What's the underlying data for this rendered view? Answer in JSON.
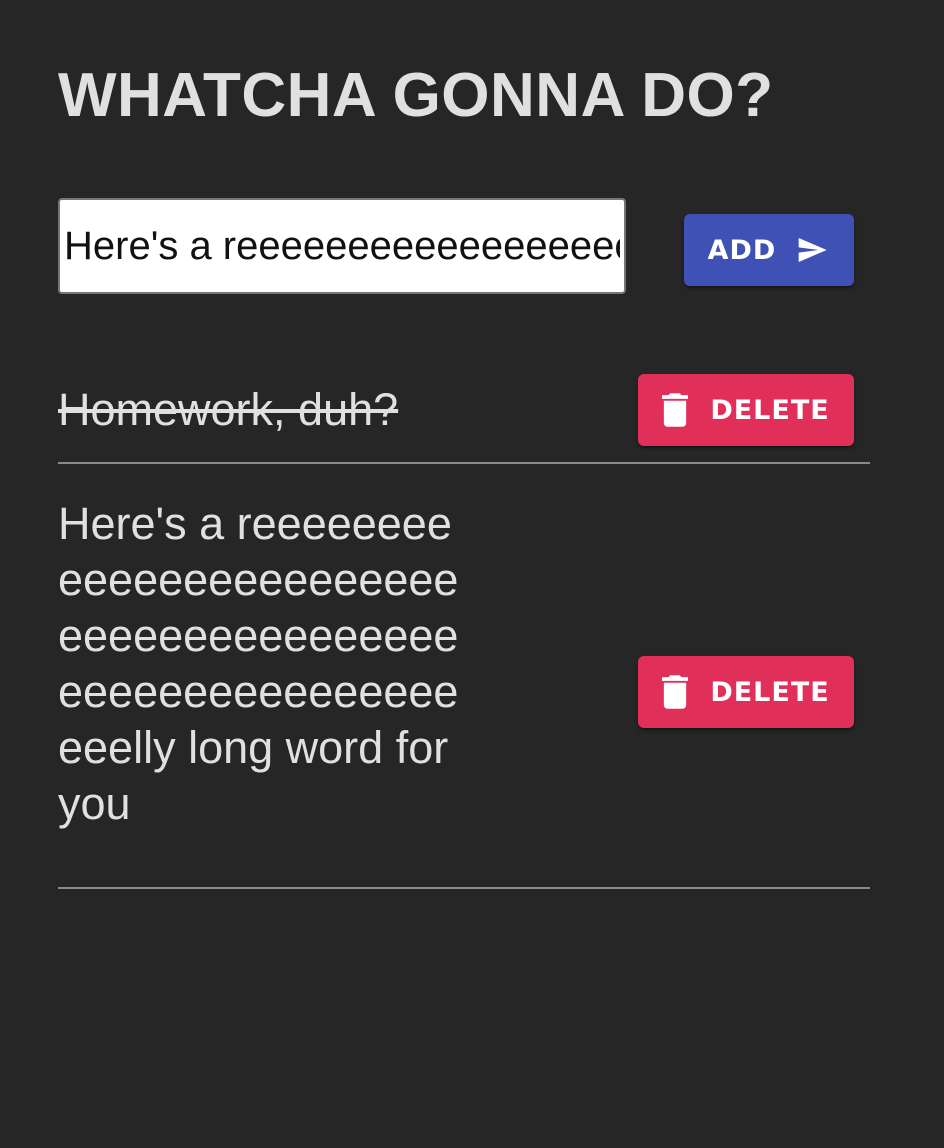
{
  "header": {
    "title": "WHATCHA GONNA DO?"
  },
  "new_todo": {
    "value": "Here's a reeeeeeeeeeeeeeeeeeeeeeeeeeeeeeeeeeeeeeeeeeeeeeeeeeeeeeeeeeelly long word for you",
    "add_label": "ADD",
    "add_icon": "send-icon"
  },
  "todos": [
    {
      "text": "Homework, duh?",
      "completed": true,
      "delete_label": "DELETE",
      "delete_icon": "trash-icon"
    },
    {
      "text": "Here's a reeeeeeeeeeeeeeeeeeeeeeeeeeeeeeeeeeeeeeeeeeeeeeeeeeeeeeeeeeelly long word for you",
      "completed": false,
      "delete_label": "DELETE",
      "delete_icon": "trash-icon"
    }
  ],
  "colors": {
    "background": "#262626",
    "text": "#e0e0e0",
    "add_button": "#3f51b5",
    "delete_button": "#e0305a",
    "divider": "#8a8a8a"
  }
}
